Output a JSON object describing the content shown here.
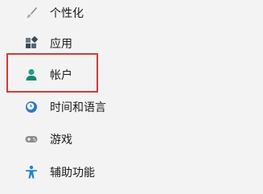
{
  "sidebar": {
    "items": [
      {
        "label": "个性化",
        "icon": "brush-icon"
      },
      {
        "label": "应用",
        "icon": "apps-icon"
      },
      {
        "label": "帐户",
        "icon": "person-icon"
      },
      {
        "label": "时间和语言",
        "icon": "clock-globe-icon"
      },
      {
        "label": "游戏",
        "icon": "gamepad-icon"
      },
      {
        "label": "辅助功能",
        "icon": "accessibility-icon"
      }
    ]
  },
  "colors": {
    "highlight_border": "#d03b3b",
    "brush": "#9a8f86",
    "apps_dark": "#3a4a5c",
    "person": "#1fa083",
    "clock": "#2b78c8",
    "gamepad": "#8e8e8e",
    "accessibility": "#1c83d4"
  }
}
